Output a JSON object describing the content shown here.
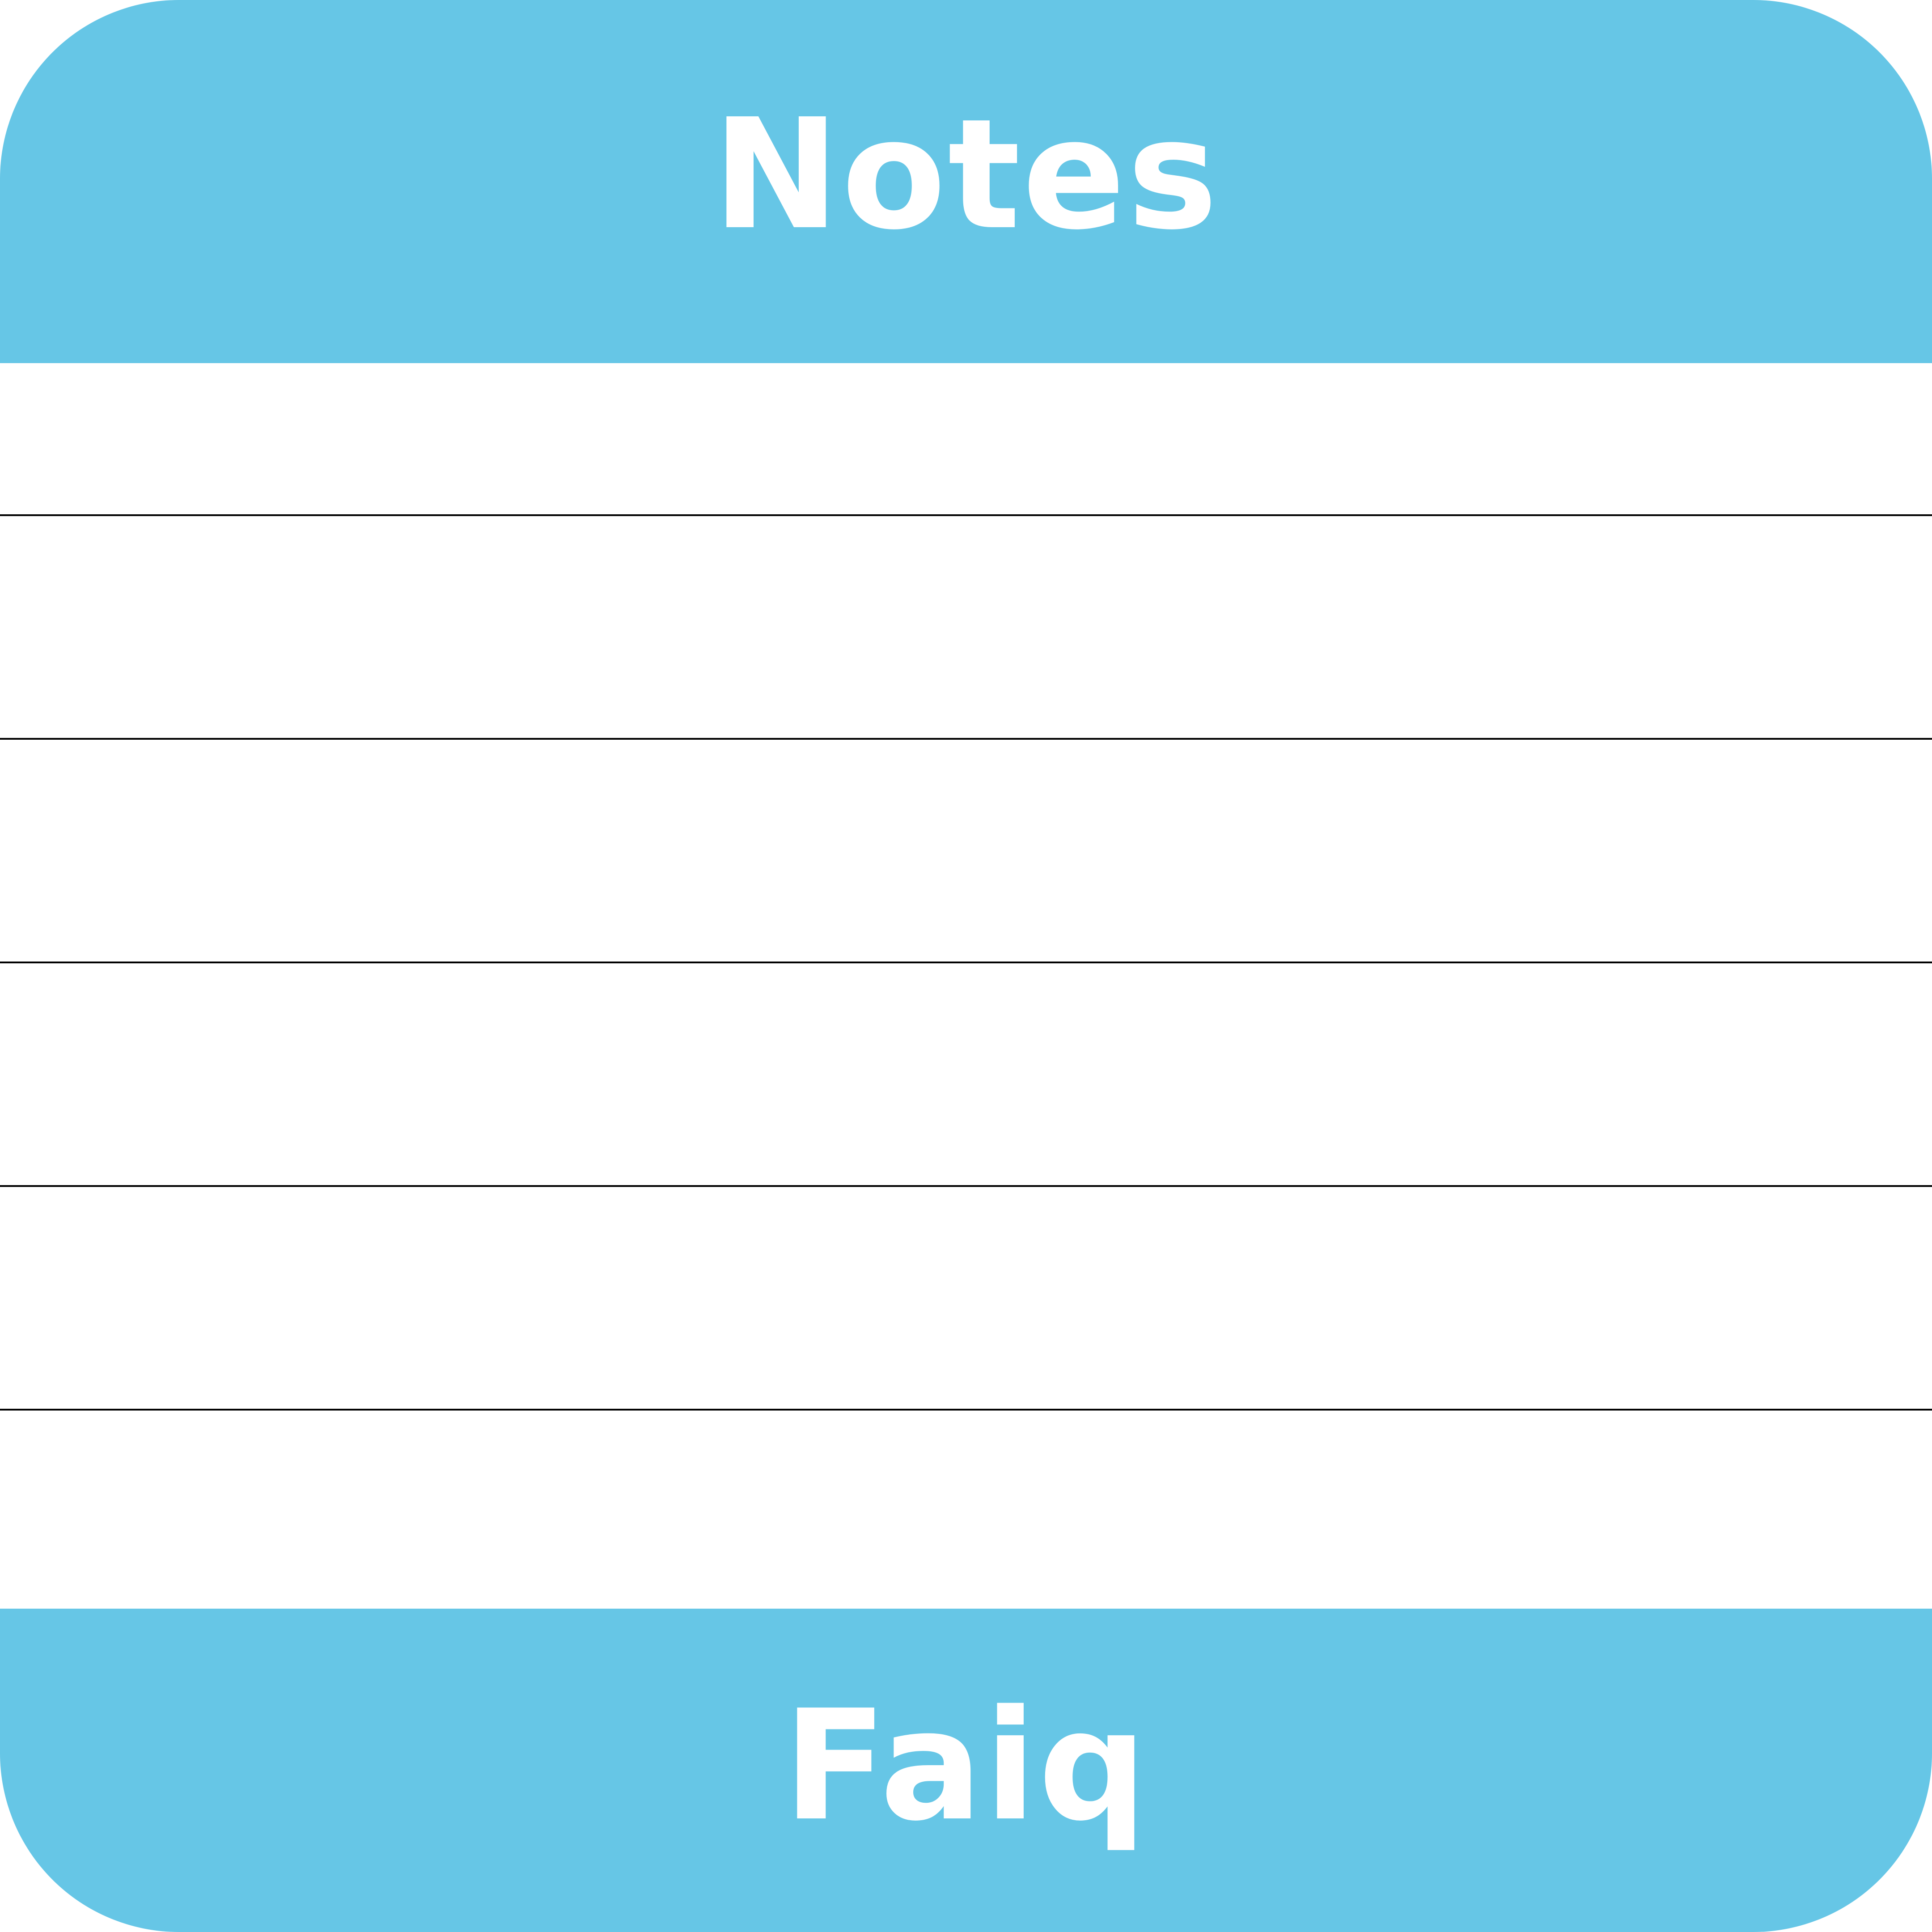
{
  "header": {
    "title": "Notes"
  },
  "footer": {
    "name": "Faiq"
  },
  "colors": {
    "band": "#66c6e6",
    "text": "#ffffff",
    "paper": "#ffffff",
    "rule": "#000000"
  }
}
